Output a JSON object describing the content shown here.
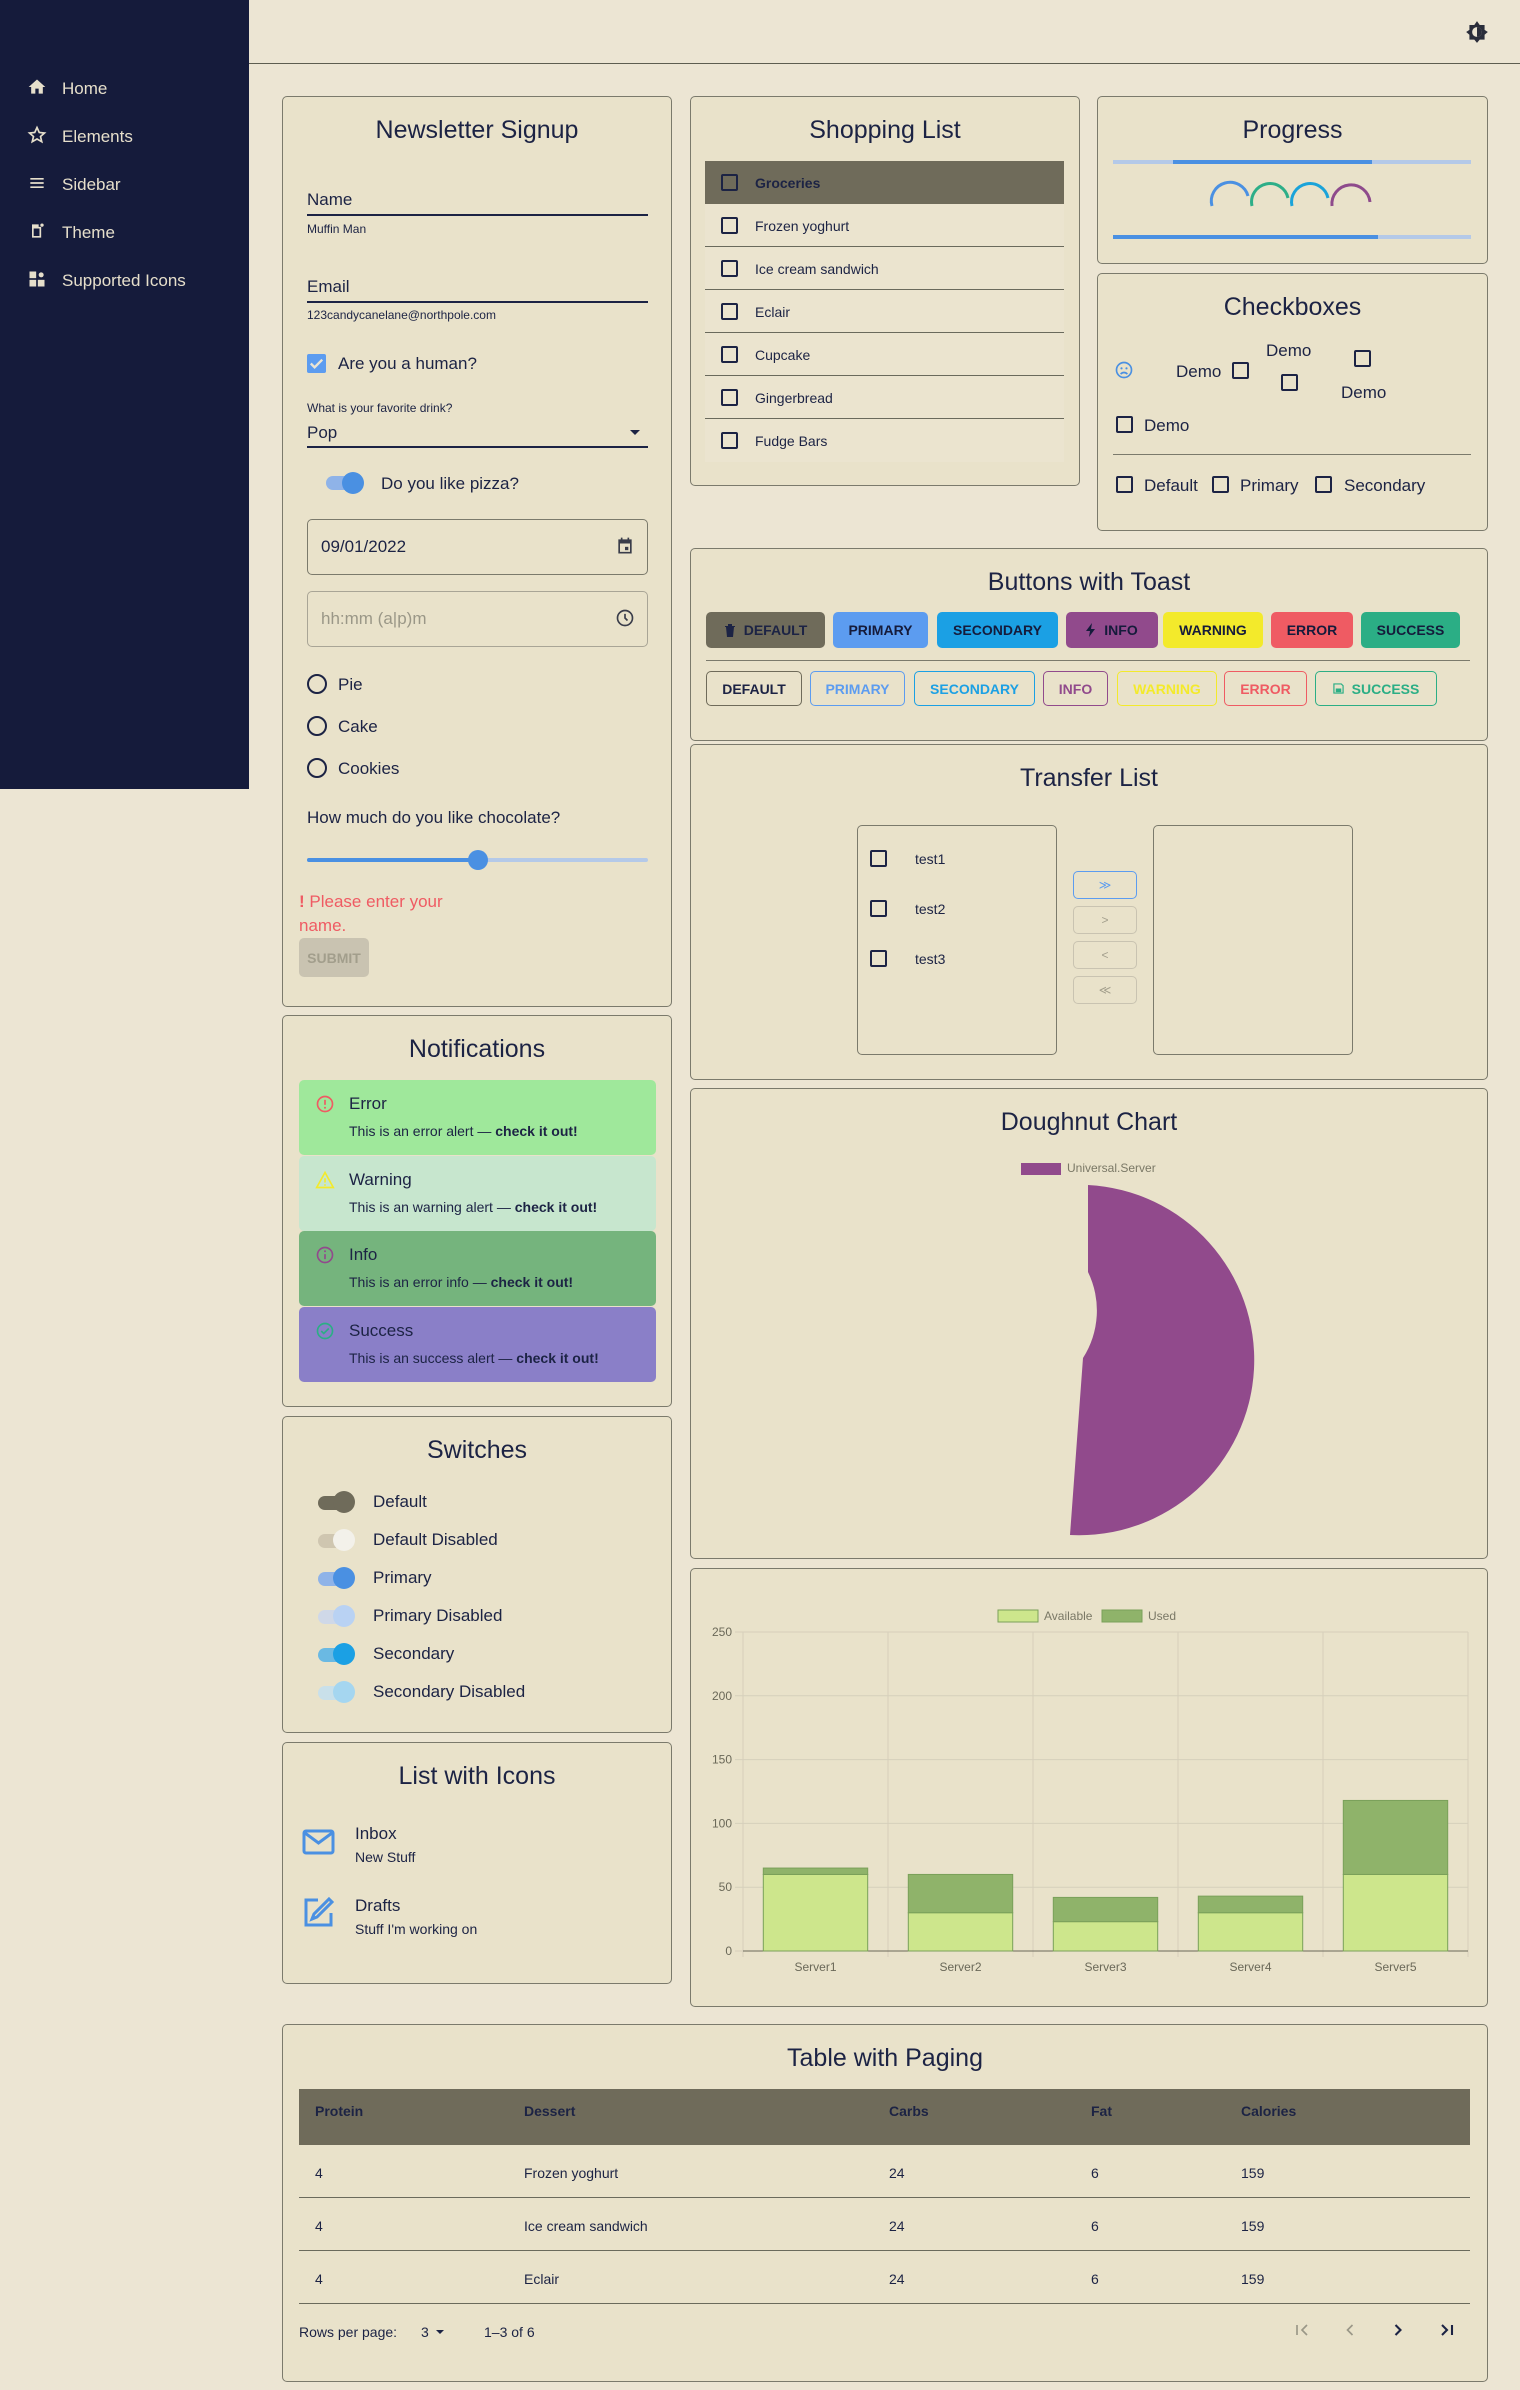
{
  "nav": {
    "items": [
      {
        "label": "Home",
        "icon": "home-icon"
      },
      {
        "label": "Elements",
        "icon": "star-icon"
      },
      {
        "label": "Sidebar",
        "icon": "menu-icon"
      },
      {
        "label": "Theme",
        "icon": "theme-icon"
      },
      {
        "label": "Supported Icons",
        "icon": "icons-icon"
      }
    ]
  },
  "topbar": {
    "theme_toggle_icon": "brightness-icon"
  },
  "newsletter": {
    "title": "Newsletter Signup",
    "name_label": "Name",
    "name_value": "Muffin Man",
    "email_label": "Email",
    "email_value": "123candycanelane@northpole.com",
    "human_label": "Are you a human?",
    "human_checked": true,
    "drink_label": "What is your favorite drink?",
    "drink_value": "Pop",
    "pizza_label": "Do you like pizza?",
    "pizza_on": true,
    "date_value": "09/01/2022",
    "time_placeholder": "hh:mm (a|p)m",
    "radios": [
      "Pie",
      "Cake",
      "Cookies"
    ],
    "slider_label": "How much do you like chocolate?",
    "slider_value": 0.5,
    "error_mark": "!",
    "error_text": "Please enter your name.",
    "submit_label": "SUBMIT"
  },
  "shopping": {
    "title": "Shopping List",
    "header": "Groceries",
    "items": [
      "Frozen yoghurt",
      "Ice cream sandwich",
      "Eclair",
      "Cupcake",
      "Gingerbread",
      "Fudge Bars"
    ]
  },
  "progress": {
    "title": "Progress",
    "bar1": 0.71,
    "bar2": 0.74,
    "spinner_colors": [
      "#4a90e2",
      "#2dae88",
      "#1aa3d9",
      "#8e4b8c"
    ]
  },
  "checkboxes": {
    "title": "Checkboxes",
    "demo": "Demo",
    "default": "Default",
    "primary": "Primary",
    "secondary": "Secondary"
  },
  "buttons": {
    "title": "Buttons with Toast",
    "filled": [
      {
        "label": "DEFAULT",
        "bg": "#6f6b5a",
        "color": "#1c2344",
        "icon": "trash-icon"
      },
      {
        "label": "PRIMARY",
        "bg": "#5c9cf0",
        "color": "#151b3b"
      },
      {
        "label": "SECONDARY",
        "bg": "#1ba0e4",
        "color": "#151b3b"
      },
      {
        "label": "INFO",
        "bg": "#914a8c",
        "color": "#151b3b",
        "icon": "bolt-icon"
      },
      {
        "label": "WARNING",
        "bg": "#f3ea2b",
        "color": "#151b3b"
      },
      {
        "label": "ERROR",
        "bg": "#ef5b63",
        "color": "#151b3b"
      },
      {
        "label": "SUCCESS",
        "bg": "#2bae85",
        "color": "#151b3b"
      }
    ],
    "outlined": [
      {
        "label": "DEFAULT",
        "color": "#1c2344",
        "border": "#6f6b5a"
      },
      {
        "label": "PRIMARY",
        "color": "#5c9cf0",
        "border": "#5c9cf0"
      },
      {
        "label": "SECONDARY",
        "color": "#1ba0e4",
        "border": "#1ba0e4"
      },
      {
        "label": "INFO",
        "color": "#914a8c",
        "border": "#914a8c"
      },
      {
        "label": "WARNING",
        "color": "#f3ea2b",
        "border": "#f3ea2b"
      },
      {
        "label": "ERROR",
        "color": "#ef5b63",
        "border": "#ef5b63"
      },
      {
        "label": "SUCCESS",
        "color": "#2bae85",
        "border": "#2bae85",
        "icon": "save-icon"
      }
    ]
  },
  "transfer": {
    "title": "Transfer List",
    "left": [
      "test1",
      "test2",
      "test3"
    ],
    "buttons": [
      "≫",
      "&gt;",
      "&lt;",
      "≪"
    ]
  },
  "notifications": {
    "title": "Notifications",
    "alerts": [
      {
        "title": "Error",
        "msg": "This is an error alert — ",
        "strong": "check it out!",
        "bg": "#9fe89b",
        "icon": "error-icon"
      },
      {
        "title": "Warning",
        "msg": "This is an warning alert — ",
        "strong": "check it out!",
        "bg": "#c7e6ce",
        "icon": "warning-icon"
      },
      {
        "title": "Info",
        "msg": "This is an error info — ",
        "strong": "check it out!",
        "bg": "#75b47d",
        "icon": "info-icon"
      },
      {
        "title": "Success",
        "msg": "This is an success alert — ",
        "strong": "check it out!",
        "bg": "#8a7fc8",
        "icon": "success-icon"
      }
    ]
  },
  "switches": {
    "title": "Switches",
    "items": [
      {
        "label": "Default",
        "on": true,
        "track": "#6f6b5a",
        "knob": "#6f6b5a"
      },
      {
        "label": "Default Disabled",
        "on": true,
        "track": "#cfc6b0",
        "knob": "#f3f1ea"
      },
      {
        "label": "Primary",
        "on": true,
        "track": "#8fb3e8",
        "knob": "#4a90e2"
      },
      {
        "label": "Primary Disabled",
        "on": true,
        "track": "#cfd8e8",
        "knob": "#b9d2f3"
      },
      {
        "label": "Secondary",
        "on": true,
        "track": "#6ab9e3",
        "knob": "#1ba0e4"
      },
      {
        "label": "Secondary Disabled",
        "on": true,
        "track": "#c9e0ea",
        "knob": "#a5d6f0"
      }
    ]
  },
  "list_icons": {
    "title": "List with Icons",
    "items": [
      {
        "title": "Inbox",
        "sub": "New Stuff",
        "icon": "mail-icon"
      },
      {
        "title": "Drafts",
        "sub": "Stuff I'm working on",
        "icon": "edit-icon"
      }
    ]
  },
  "doughnut": {
    "title": "Doughnut Chart"
  },
  "chart_data": [
    {
      "type": "pie",
      "title": "Doughnut Chart",
      "legend": [
        "Universal.Server"
      ],
      "values": [
        100
      ],
      "color": "#914a8c"
    },
    {
      "type": "bar",
      "stacked": true,
      "categories": [
        "Server1",
        "Server2",
        "Server3",
        "Server4",
        "Server5"
      ],
      "series": [
        {
          "name": "Available",
          "values": [
            60,
            30,
            23,
            30,
            60
          ],
          "color": "#cde68c"
        },
        {
          "name": "Used",
          "values": [
            5,
            30,
            19,
            13,
            58
          ],
          "color": "#8fb36a"
        }
      ],
      "yticks": [
        0,
        50,
        100,
        150,
        200,
        250
      ],
      "ylim": [
        0,
        250
      ],
      "legend": "top-center",
      "grid": true
    }
  ],
  "table": {
    "title": "Table with Paging",
    "columns": [
      "Protein",
      "Dessert",
      "Carbs",
      "Fat",
      "Calories"
    ],
    "rows": [
      [
        "4",
        "Frozen yoghurt",
        "24",
        "6",
        "159"
      ],
      [
        "4",
        "Ice cream sandwich",
        "24",
        "6",
        "159"
      ],
      [
        "4",
        "Eclair",
        "24",
        "6",
        "159"
      ]
    ],
    "rows_per_page_label": "Rows per page:",
    "rows_per_page": "3",
    "range": "1–3 of 6"
  }
}
